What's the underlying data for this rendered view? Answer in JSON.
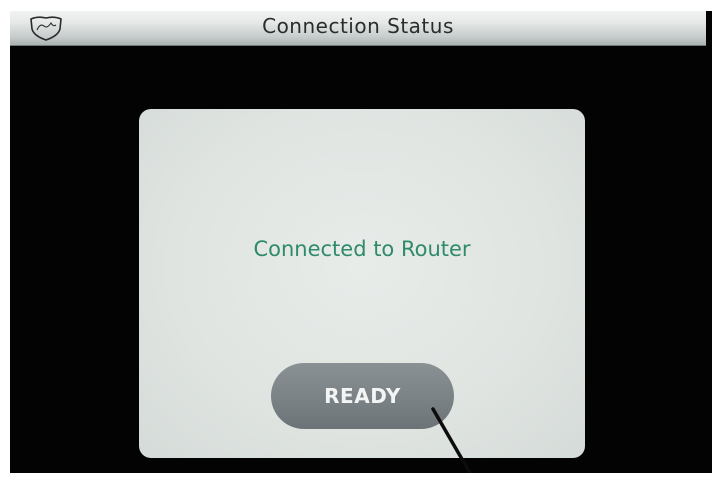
{
  "header": {
    "title": "Connection Status",
    "logo_icon": "shield-logo-icon"
  },
  "main": {
    "status_message": "Connected to Router",
    "ready_button_label": "READY"
  },
  "colors": {
    "screen_background": "#030303",
    "title_bar": "#d4d9d8",
    "panel_background": "#e0e5e2",
    "status_text": "#2f8a6b",
    "button_background": "#7b8286",
    "button_text": "#f3f5f5"
  }
}
